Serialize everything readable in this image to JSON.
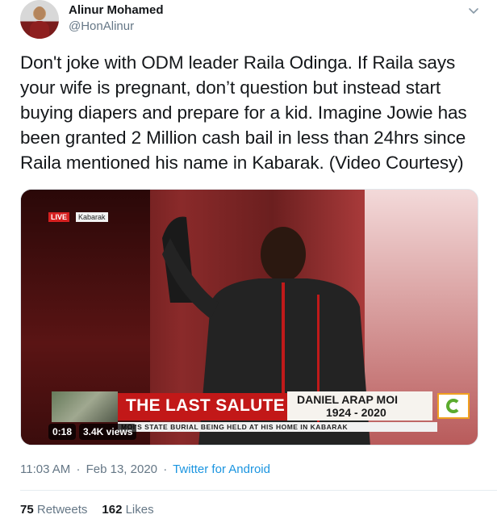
{
  "tweet": {
    "author": {
      "name": "Alinur Mohamed",
      "handle": "@HonAlinur"
    },
    "text": "Don't joke with ODM leader Raila Odinga. If Raila says your wife is pregnant, don’t question but instead start buying diapers and prepare for a kid. Imagine Jowie has been granted 2 Million cash bail in less than 24hrs since Raila mentioned his name in Kabarak. (Video Courtesy)",
    "video": {
      "live_tag": "LIVE",
      "live_location": "Kabarak",
      "headline": "THE LAST SALUTE",
      "name_line1": "DANIEL ARAP MOI",
      "name_line2": "1924 - 2020",
      "ticker": "MOI'S STATE BURIAL BEING HELD AT HIS HOME IN KABARAK",
      "duration": "0:18",
      "views": "3.4K views"
    },
    "meta": {
      "time": "11:03 AM",
      "date": "Feb 13, 2020",
      "separator": "·",
      "source": "Twitter for Android"
    },
    "stats": {
      "retweets_count": "75",
      "retweets_label": "Retweets",
      "likes_count": "162",
      "likes_label": "Likes"
    },
    "icons": {
      "menu": "chevron-down-icon",
      "avatar": "avatar"
    }
  }
}
